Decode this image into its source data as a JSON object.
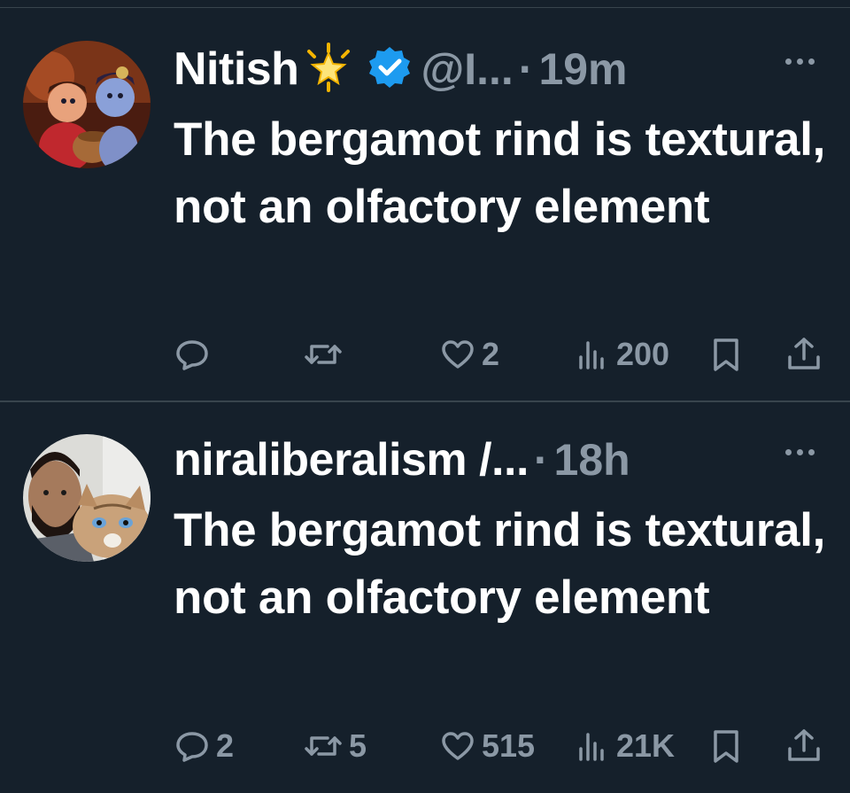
{
  "tweets": [
    {
      "name": "Nitish",
      "handle": "@I...",
      "dot": "·",
      "time": "19m",
      "text": "The bergamot rind is textural, not an olfactory element",
      "replies": "",
      "retweets": "",
      "likes": "2",
      "views": "200"
    },
    {
      "name": "niraliberalism /...",
      "handle": "",
      "dot": "·",
      "time": "18h",
      "text": "The bergamot rind is textural, not an olfactory element",
      "replies": "2",
      "retweets": "5",
      "likes": "515",
      "views": "21K"
    }
  ],
  "icons": [
    "more-icon",
    "reply-icon",
    "retweet-icon",
    "like-icon",
    "views-icon",
    "bookmark-icon",
    "share-icon",
    "verified-icon",
    "star-emoji"
  ],
  "colors": {
    "background": "#15202b",
    "muted": "#8b98a5",
    "verified": "#1d9bf0",
    "divider": "#38444d"
  }
}
